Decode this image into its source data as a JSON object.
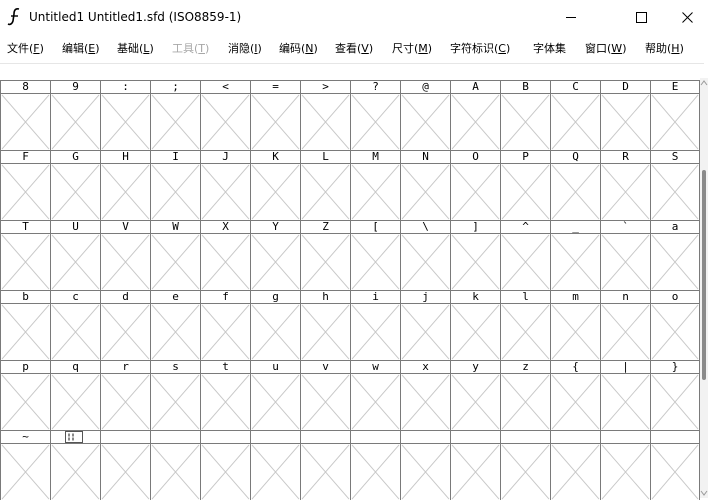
{
  "window": {
    "title": "Untitled1  Untitled1.sfd (ISO8859-1)",
    "controls": {
      "minimize": "minimize",
      "maximize": "maximize",
      "close": "close"
    }
  },
  "menubar": [
    {
      "label": "文件(",
      "acc": "F",
      "end": ")",
      "enabled": true
    },
    {
      "label": "编辑(",
      "acc": "E",
      "end": ")",
      "enabled": true
    },
    {
      "label": "基础(",
      "acc": "L",
      "end": ")",
      "enabled": true
    },
    {
      "label": "工具(",
      "acc": "T",
      "end": ")",
      "enabled": false
    },
    {
      "label": "消隐(",
      "acc": "I",
      "end": ")",
      "enabled": true
    },
    {
      "label": "编码(",
      "acc": "N",
      "end": ")",
      "enabled": true
    },
    {
      "label": "查看(",
      "acc": "V",
      "end": ")",
      "enabled": true
    },
    {
      "label": "尺寸(",
      "acc": "M",
      "end": ")",
      "enabled": true
    },
    {
      "label": "字符标识(",
      "acc": "C",
      "end": ")",
      "enabled": true
    },
    {
      "label": "字体集",
      "acc": "",
      "end": "",
      "enabled": true
    },
    {
      "label": "窗口(",
      "acc": "W",
      "end": ")",
      "enabled": true
    },
    {
      "label": "帮助(",
      "acc": "H",
      "end": ")",
      "enabled": true
    }
  ],
  "font_view": {
    "rows": [
      [
        "8",
        "9",
        ":",
        ";",
        "<",
        "=",
        ">",
        "?",
        "@",
        "A",
        "B",
        "C",
        "D",
        "E"
      ],
      [
        "F",
        "G",
        "H",
        "I",
        "J",
        "K",
        "L",
        "M",
        "N",
        "O",
        "P",
        "Q",
        "R",
        "S"
      ],
      [
        "T",
        "U",
        "V",
        "W",
        "X",
        "Y",
        "Z",
        "[",
        "\\",
        "]",
        "^",
        "_",
        "`",
        "a"
      ],
      [
        "b",
        "c",
        "d",
        "e",
        "f",
        "g",
        "h",
        "i",
        "j",
        "k",
        "l",
        "m",
        "n",
        "o"
      ],
      [
        "p",
        "q",
        "r",
        "s",
        "t",
        "u",
        "v",
        "w",
        "x",
        "y",
        "z",
        "{",
        "|",
        "}"
      ],
      [
        "~",
        "",
        "",
        "",
        "",
        "",
        "",
        "",
        "",
        "",
        "",
        "",
        "",
        ""
      ]
    ],
    "special_cells": [
      {
        "row": 5,
        "col": 1,
        "icon": "unicode-box-icon"
      }
    ],
    "empty_marker_icon": "cross-icon"
  },
  "colors": {
    "grid_line": "#7a7a7a",
    "cross": "#c8c8c8",
    "disabled_menu": "#a8a8a8"
  }
}
